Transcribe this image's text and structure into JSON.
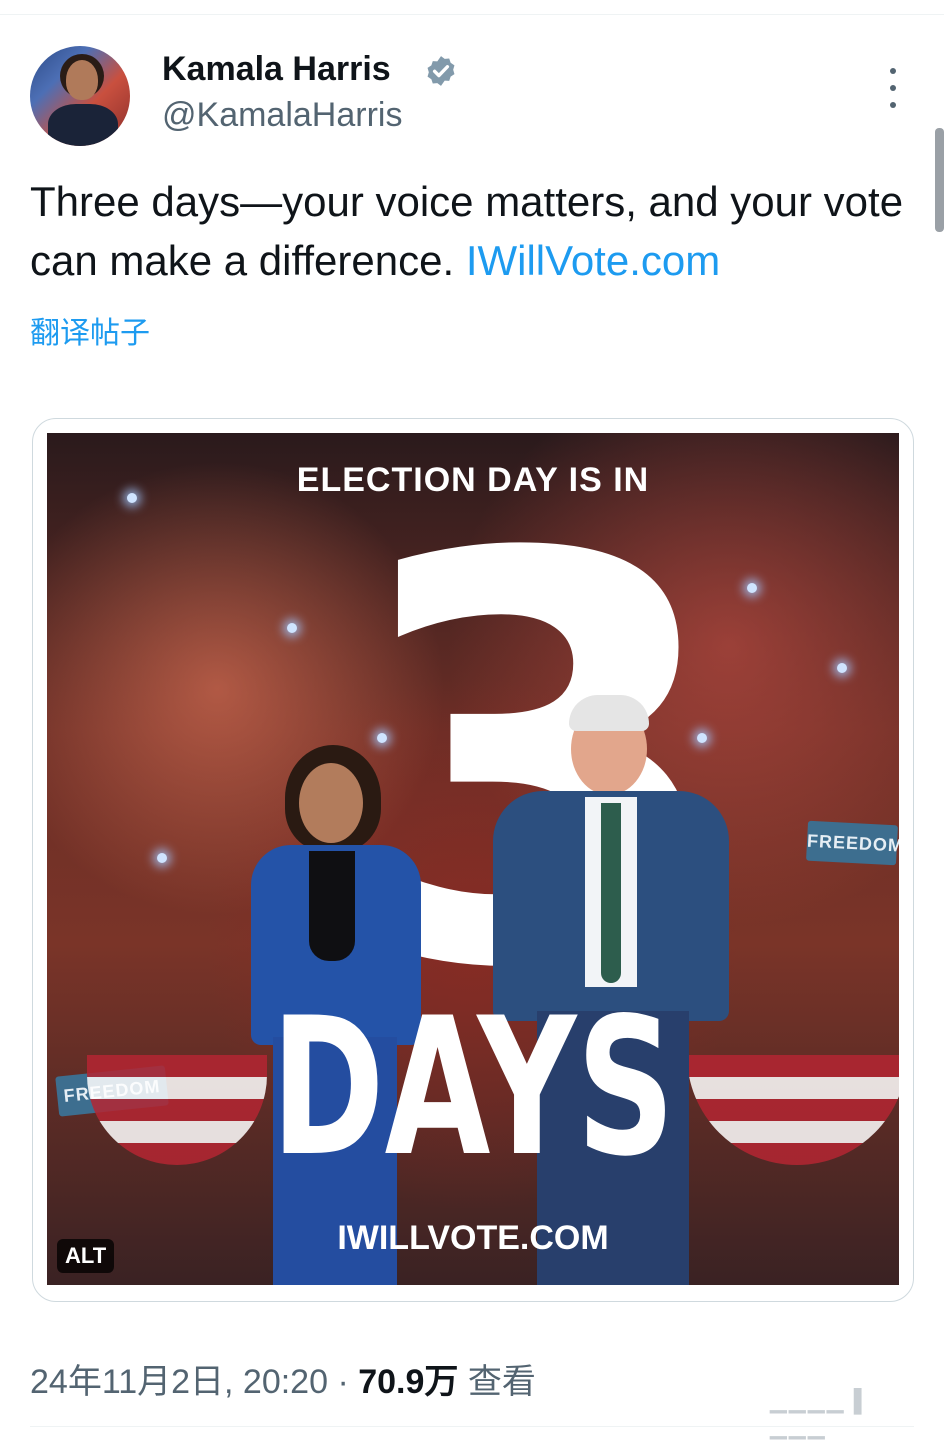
{
  "author": {
    "name": "Kamala Harris",
    "handle": "@KamalaHarris",
    "verified": true
  },
  "tweet": {
    "text": "Three days—your voice matters, and your vote can make a difference. ",
    "link": "IWillVote.com",
    "translate_label": "翻译帖子"
  },
  "media": {
    "headline": "ELECTION DAY IS IN",
    "number": "3",
    "days_word": "DAYS",
    "url": "IWILLVOTE.COM",
    "alt_label": "ALT",
    "sign_text": "FREEDOM"
  },
  "meta": {
    "timestamp": "24年11月2日, 20:20",
    "separator": " · ",
    "views": "70.9万",
    "views_label": " 查看"
  },
  "colors": {
    "link": "#1d9bf0",
    "verified": "#829aab",
    "muted": "#536471"
  }
}
